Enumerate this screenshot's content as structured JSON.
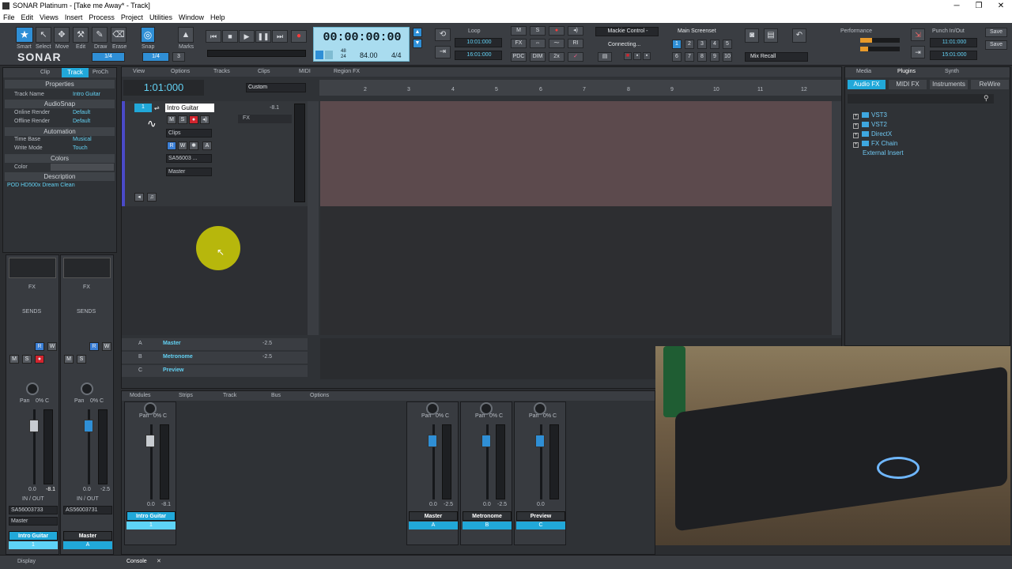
{
  "title": "SONAR Platinum - [Take me Away* - Track]",
  "menu": [
    "File",
    "Edit",
    "Views",
    "Insert",
    "Process",
    "Project",
    "Utilities",
    "Window",
    "Help"
  ],
  "tools": {
    "smart": "Smart",
    "select": "Select",
    "move": "Move",
    "edit": "Edit",
    "draw": "Draw",
    "erase": "Erase",
    "snap": "Snap",
    "marks": "Marks",
    "snap_value": "1/4",
    "snap_value2": "1/4",
    "snap_num": "3"
  },
  "brand": "SONAR",
  "transport": {
    "time": "00:00:00:00",
    "tempo": "84.00",
    "meter": "4/4",
    "sig_top": "48",
    "sig_bottom": "24"
  },
  "loop": {
    "label": "Loop",
    "start": "10:01:000",
    "end": "16:01:000"
  },
  "control_surface": {
    "name": "Mackie Control -",
    "status": "Connecting..."
  },
  "mix_buttons": [
    "M",
    "S",
    "FX",
    "PDC",
    "DIM",
    "2x"
  ],
  "screensets": {
    "label": "Main Screenset",
    "numbers": [
      "1",
      "2",
      "3",
      "4",
      "5",
      "6",
      "7",
      "8",
      "9",
      "10"
    ],
    "mix_recall": "Mix Recall"
  },
  "performance": {
    "label": "Performance"
  },
  "punch": {
    "label": "Punch In/Out",
    "start": "11:01:000",
    "end": "15:01:000"
  },
  "save": [
    "Save",
    "Save"
  ],
  "inspector": {
    "tabs": [
      "Clip",
      "Track",
      "ProCh"
    ],
    "sections": {
      "properties": "Properties",
      "audiosnap": "AudioSnap",
      "automation": "Automation",
      "colors": "Colors",
      "description": "Description"
    },
    "rows": [
      {
        "k": "Track Name",
        "v": "Intro Guitar"
      },
      {
        "k": "Online Render",
        "v": "Default"
      },
      {
        "k": "Offline Render",
        "v": "Default"
      },
      {
        "k": "Time Base",
        "v": "Musical"
      },
      {
        "k": "Write Mode",
        "v": "Touch"
      },
      {
        "k": "Color",
        "v": ""
      }
    ],
    "description": "POD HD500x Dream Clean"
  },
  "track_view": {
    "menus": [
      "View",
      "Options",
      "Tracks",
      "Clips",
      "MIDI",
      "Region FX"
    ],
    "now_time": "1:01:000",
    "preset": "Custom",
    "ruler": [
      "2",
      "3",
      "4",
      "5",
      "6",
      "7",
      "8",
      "9",
      "10",
      "11",
      "12"
    ],
    "track": {
      "num": "1",
      "name": "Intro Guitar",
      "volume": "-8.1",
      "clips": "Clips",
      "input": "SA56003 ...",
      "output": "Master",
      "fx": "FX",
      "buttons": [
        "M",
        "S",
        "R",
        "W"
      ]
    },
    "buses": [
      {
        "letter": "A",
        "name": "Master",
        "vol": "-2.5"
      },
      {
        "letter": "B",
        "name": "Metronome",
        "vol": "-2.5"
      },
      {
        "letter": "C",
        "name": "Preview",
        "vol": ""
      }
    ]
  },
  "left_strips": [
    {
      "fx": "FX",
      "sends": "SENDS",
      "pan": "Pan",
      "pan_val": "0% C",
      "vol": "0.0",
      "peak": "-8.1",
      "io": "IN / OUT",
      "input": "SA56003733",
      "output": "Master",
      "name": "Intro Guitar",
      "num": "1"
    },
    {
      "fx": "FX",
      "sends": "SENDS",
      "pan": "Pan",
      "pan_val": "0% C",
      "vol": "0.0",
      "peak": "-2.5",
      "io": "IN / OUT",
      "input": "AS56003731",
      "output": "",
      "name": "Master",
      "num": "A"
    }
  ],
  "console": {
    "menus": [
      "Modules",
      "Strips",
      "Track",
      "Bus",
      "Options"
    ],
    "strips": [
      {
        "pan": "Pan",
        "pan_val": "0% C",
        "vol": "0.0",
        "peak": "-8.1",
        "name": "Intro Guitar",
        "num": "1"
      },
      {
        "pan": "Pan",
        "pan_val": "0% C",
        "vol": "0.0",
        "peak": "-2.5",
        "name": "Master",
        "num": "A"
      },
      {
        "pan": "Pan",
        "pan_val": "0% C",
        "vol": "0.0",
        "peak": "-2.5",
        "name": "Metronome",
        "num": "B"
      },
      {
        "pan": "Pan",
        "pan_val": "0% C",
        "vol": "0.0",
        "peak": "",
        "name": "Preview",
        "num": "C"
      }
    ],
    "scale": [
      "6",
      "0",
      "-6",
      "-12",
      "-18",
      "-24",
      "-30",
      "-42",
      "-54"
    ]
  },
  "browser": {
    "tabs": [
      "Media",
      "Plugins",
      "Synth"
    ],
    "subtabs": [
      "Audio FX",
      "MIDI FX",
      "Instruments",
      "ReWire"
    ],
    "tree": [
      "VST3",
      "VST2",
      "DirectX",
      "FX Chain",
      "External Insert"
    ]
  },
  "bottom": {
    "display": "Display",
    "console": "Console"
  },
  "colors": {
    "accent": "#21a8d9",
    "record": "#d2242e",
    "clip_bg": "#5c4a4d",
    "time_display": "#a9dcef"
  }
}
